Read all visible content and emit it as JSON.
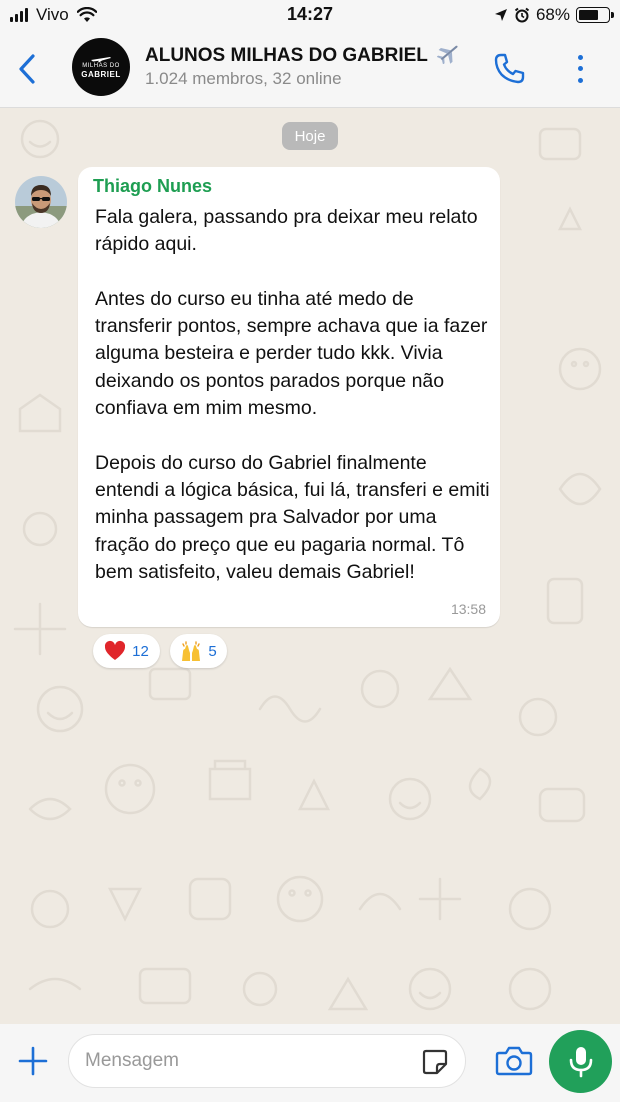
{
  "status_bar": {
    "carrier": "Vivo",
    "time": "14:27",
    "battery": "68%",
    "battery_level": 0.68
  },
  "header": {
    "title": "ALUNOS MILHAS DO GABRIEL",
    "subtitle": "1.024 membros, 32 online",
    "avatar_text_1": "MILHAS DO",
    "avatar_text_2": "GABRIEL"
  },
  "chat": {
    "date_chip": "Hoje",
    "message": {
      "sender": "Thiago Nunes",
      "sender_color": "#1e9e52",
      "paragraphs": [
        "Fala galera, passando pra deixar meu relato rápido aqui.",
        "Antes do curso eu tinha até medo de transferir pontos, sempre achava que ia fazer alguma besteira e perder tudo kkk. Vivia deixando os pontos parados porque não confiava em mim mesmo.",
        "Depois do curso do Gabriel finalmente entendi a lógica básica, fui lá, transferi e emiti minha passagem pra Salvador por uma fração do preço que eu pagaria normal. Tô bem satisfeito, valeu demais Gabriel!"
      ],
      "time": "13:58"
    },
    "reactions": [
      {
        "emoji": "heart",
        "count": "12"
      },
      {
        "emoji": "raising-hands",
        "count": "5"
      }
    ]
  },
  "input_bar": {
    "placeholder": "Mensagem"
  },
  "colors": {
    "accent": "#1d6fd6",
    "mic_button": "#21a05a",
    "chat_background": "#efeae2"
  }
}
